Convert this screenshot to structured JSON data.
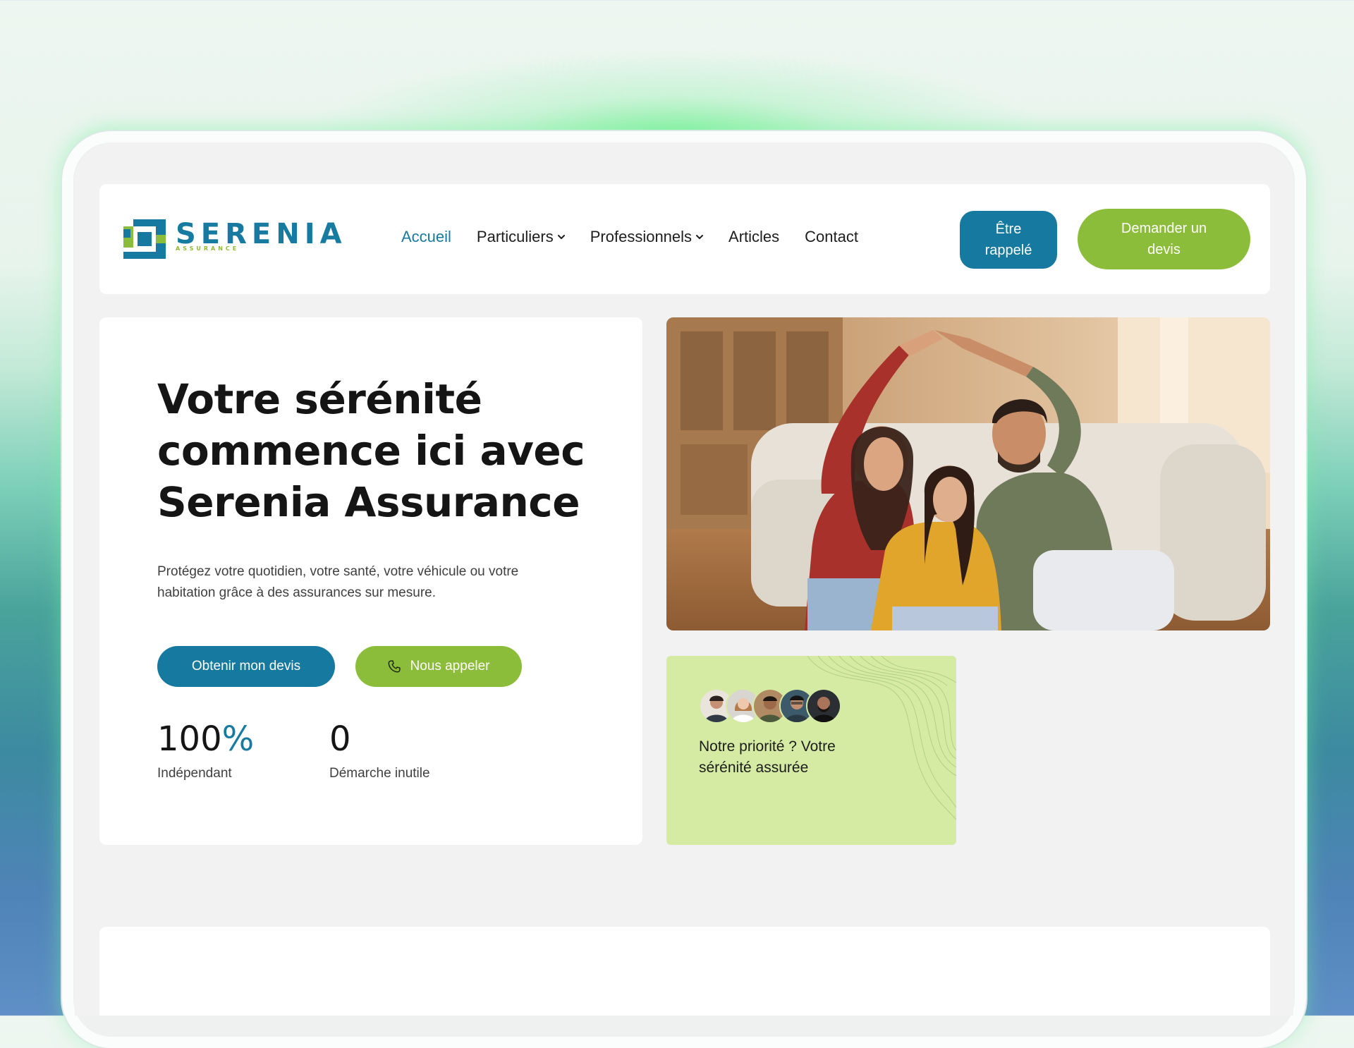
{
  "brand": {
    "name": "SERENIA",
    "sub": "ASSURANCE",
    "colors": {
      "primary": "#167aa0",
      "accent": "#8cbd3a",
      "soft_green": "#d5eba3"
    }
  },
  "nav": {
    "items": [
      {
        "label": "Accueil",
        "active": true
      },
      {
        "label": "Particuliers",
        "dropdown": true
      },
      {
        "label": "Professionnels",
        "dropdown": true
      },
      {
        "label": "Articles"
      },
      {
        "label": "Contact"
      }
    ]
  },
  "header_buttons": {
    "callback": {
      "line1": "Être",
      "line2": "rappelé"
    },
    "quote": {
      "line1": "Demander un",
      "line2": "devis"
    }
  },
  "hero": {
    "title_line1": "Votre sérénité",
    "title_line2": "commence ici avec",
    "title_line3": "Serenia Assurance",
    "text_line1": "Protégez votre quotidien, votre santé, votre véhicule ou votre",
    "text_line2": "habitation grâce à des assurances sur mesure.",
    "btn_devis": "Obtenir mon devis",
    "btn_call": "Nous appeler",
    "btn_call_icon": "phone-icon"
  },
  "stats": [
    {
      "value": "100",
      "suffix": "%",
      "label": "Indépendant"
    },
    {
      "value": "0",
      "suffix": "",
      "label": "Démarche inutile"
    }
  ],
  "promo": {
    "text_line1": "Notre priorité ? Votre",
    "text_line2": "sérénité assurée",
    "avatar_count": 5
  }
}
